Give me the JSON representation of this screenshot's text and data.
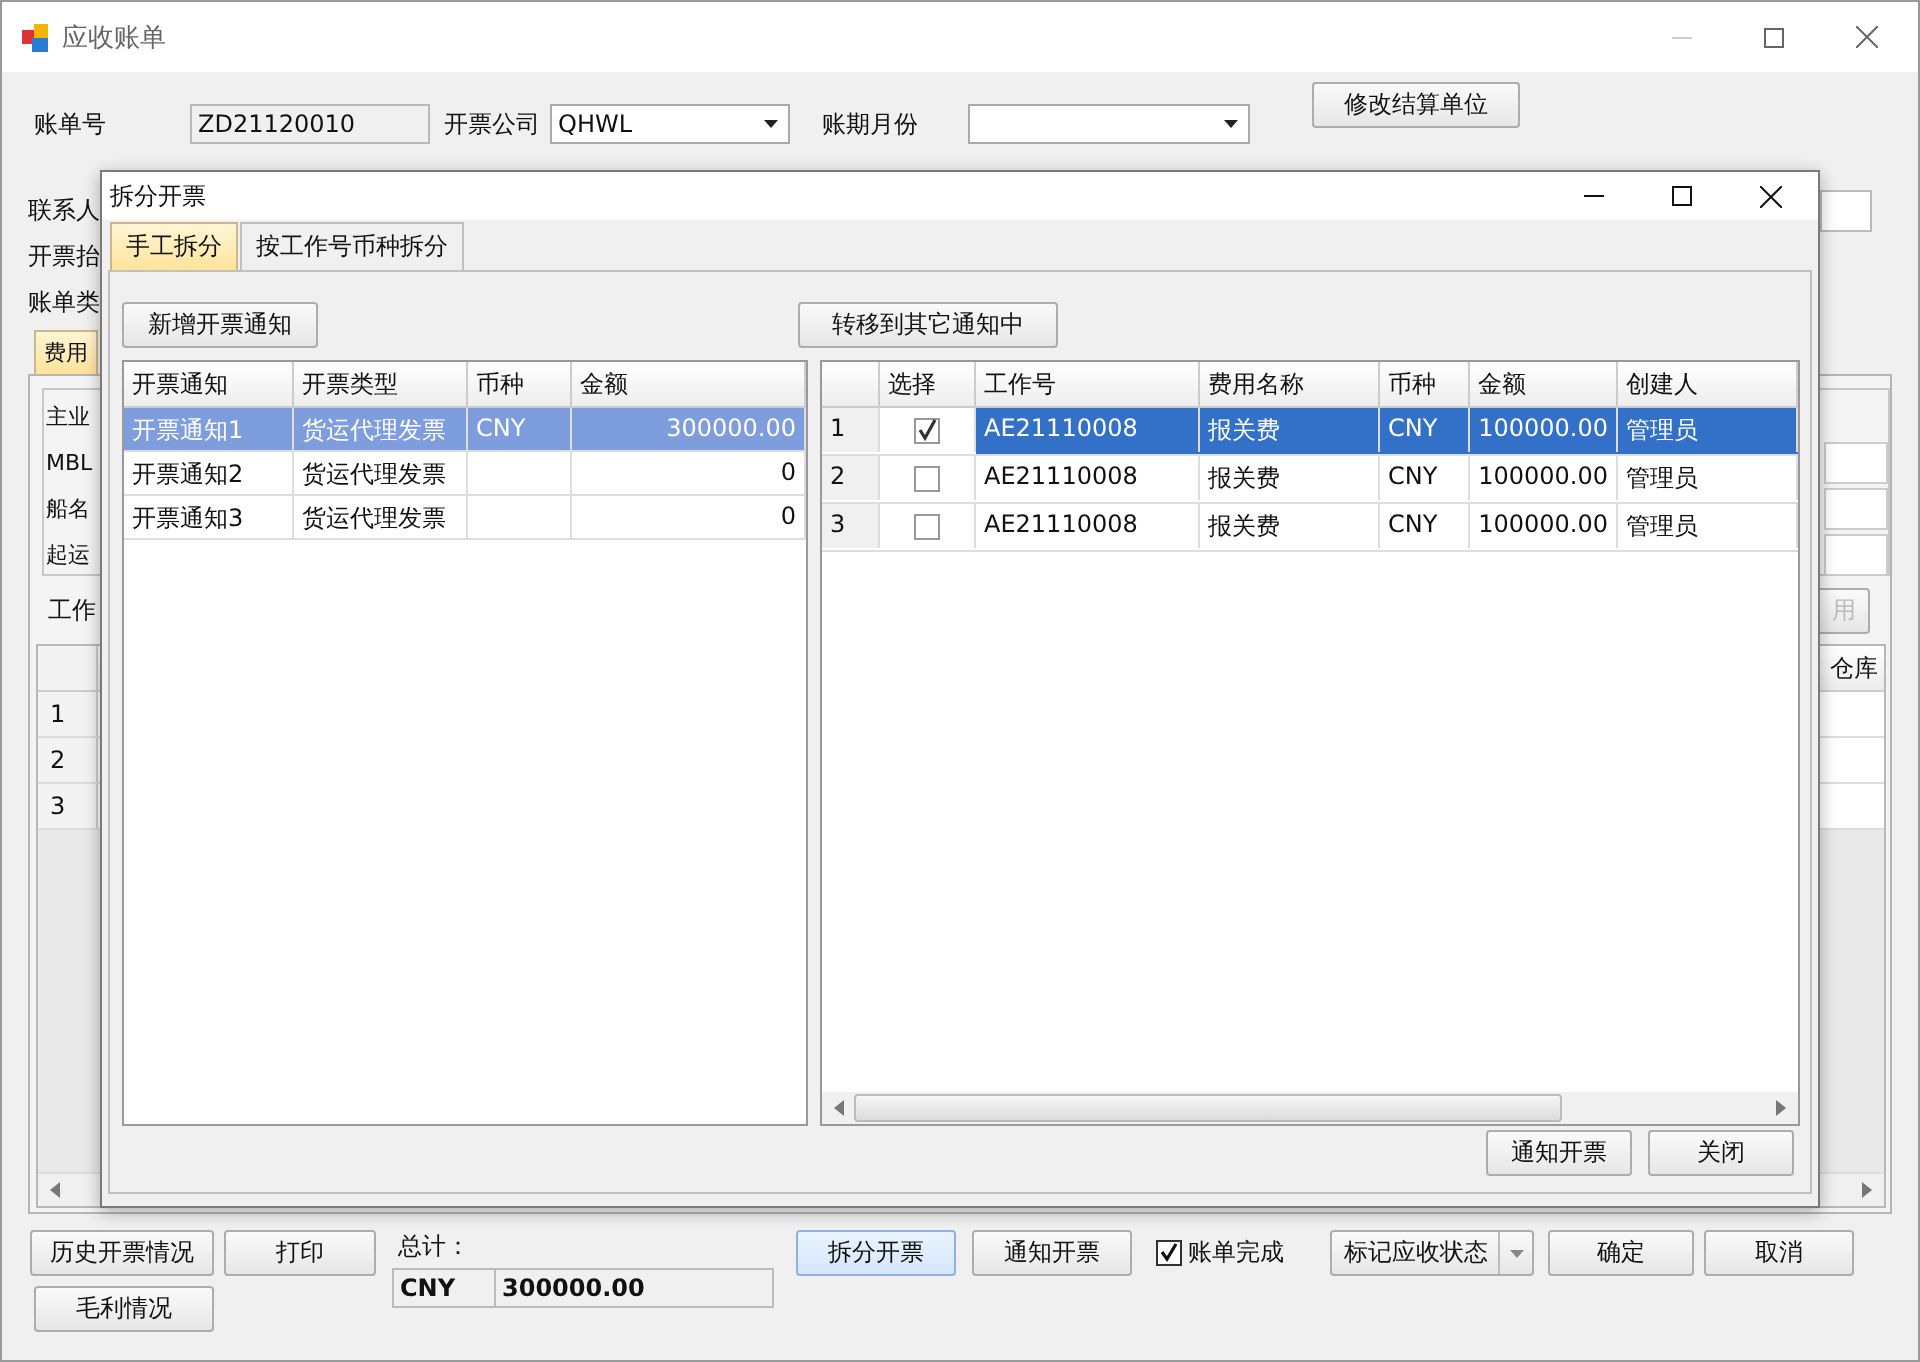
{
  "window": {
    "title": "应收账单"
  },
  "top_form": {
    "bill_no_label": "账单号",
    "bill_no": "ZD21120010",
    "company_label": "开票公司",
    "company": "QHWL",
    "period_label": "账期月份",
    "edit_button": "修改结算单位"
  },
  "left_labels": [
    "联系人",
    "开票抬",
    "账单类"
  ],
  "main_tab": {
    "label": "费用"
  },
  "group_labels": [
    "主业",
    "MBL",
    "船名",
    "起运"
  ],
  "work_label": "工作",
  "disabled_button": "用",
  "grid": {
    "last_column": "仓库",
    "row_numbers": [
      "1",
      "2",
      "3"
    ]
  },
  "bottom": {
    "history_button": "历史开票情况",
    "profit_button": "毛利情况",
    "print_button": "打印",
    "total_label": "总计：",
    "total_currency": "CNY",
    "total_amount": "300000.00",
    "actions": [
      {
        "label": "拆分开票",
        "highlighted": true
      },
      {
        "label": "通知开票",
        "highlighted": false
      }
    ],
    "done": {
      "label": "账单完成",
      "checked": true
    },
    "status_dropdown": "标记应收状态",
    "ok": "确定",
    "cancel": "取消"
  },
  "dialog": {
    "title": "拆分开票",
    "tabs": [
      {
        "label": "手工拆分",
        "selected": true
      },
      {
        "label": "按工作号币种拆分",
        "selected": false
      }
    ],
    "add_button": "新增开票通知",
    "move_button": "转移到其它通知中",
    "notices": {
      "columns": [
        "开票通知",
        "开票类型",
        "币种",
        "金额"
      ],
      "rows": [
        {
          "name": "开票通知1",
          "type": "货运代理发票",
          "currency": "CNY",
          "amount": "300000.00",
          "selected": true
        },
        {
          "name": "开票通知2",
          "type": "货运代理发票",
          "amount": "0",
          "selected": false
        },
        {
          "name": "开票通知3",
          "type": "货运代理发票",
          "amount": "0",
          "selected": false
        }
      ]
    },
    "charges": {
      "columns": [
        "选择",
        "工作号",
        "费用名称",
        "币种",
        "金额",
        "创建人"
      ],
      "rows": [
        {
          "number": "1",
          "checked": true,
          "job_no": "AE21110008",
          "fee": "报关费",
          "currency": "CNY",
          "amount": "100000.00",
          "creator": "管理员",
          "selected": true
        },
        {
          "number": "2",
          "checked": false,
          "job_no": "AE21110008",
          "fee": "报关费",
          "currency": "CNY",
          "amount": "100000.00",
          "creator": "管理员",
          "selected": false
        },
        {
          "number": "3",
          "checked": false,
          "job_no": "AE21110008",
          "fee": "报关费",
          "currency": "CNY",
          "amount": "100000.00",
          "creator": "管理员",
          "selected": false
        }
      ]
    },
    "notify_button": "通知开票",
    "close_button": "关闭"
  }
}
